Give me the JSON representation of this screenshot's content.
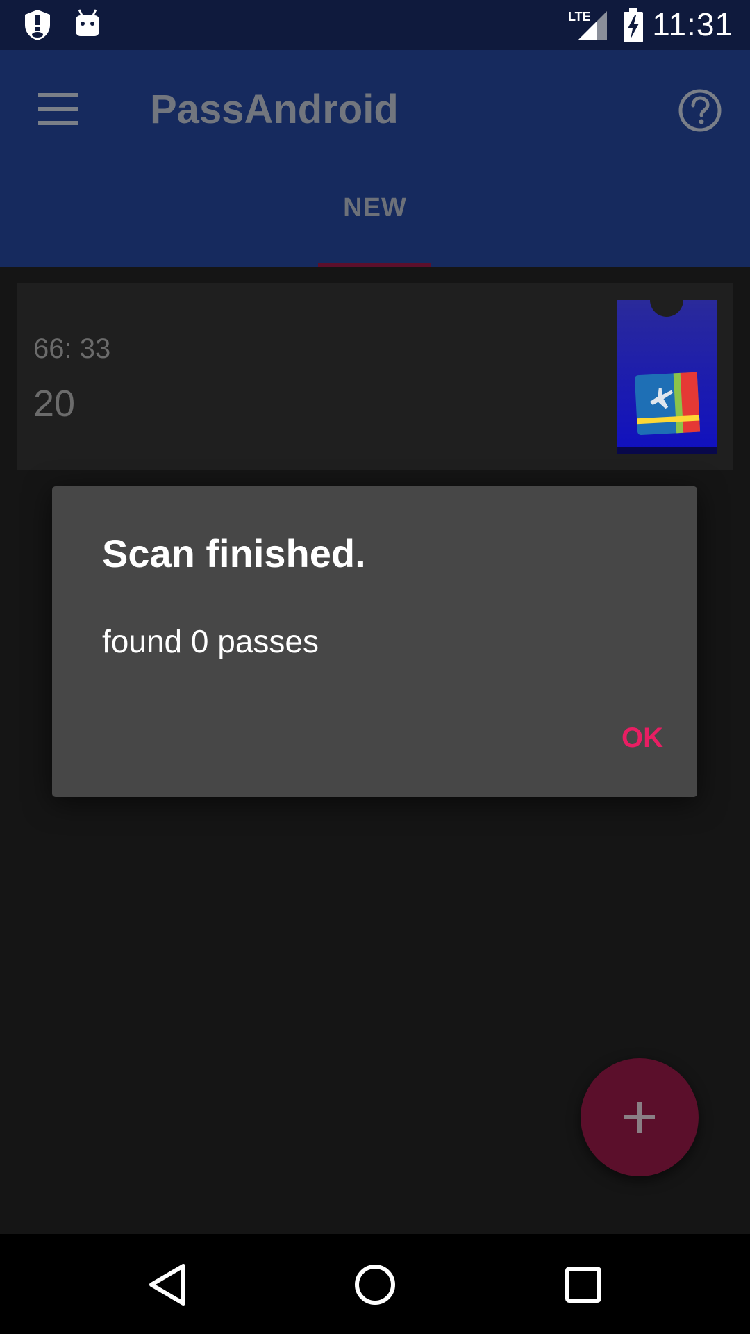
{
  "status_bar": {
    "time": "11:31",
    "network_label": "LTE",
    "icons": [
      "vpn-shield-icon",
      "android-debug-icon",
      "lte-signal-icon",
      "battery-charging-icon"
    ]
  },
  "app_bar": {
    "title": "PassAndroid",
    "menu_icon": "hamburger-menu-icon",
    "help_icon": "help-circle-icon",
    "tabs": [
      {
        "label": "NEW",
        "selected": true
      }
    ]
  },
  "pass_list": {
    "items": [
      {
        "line1": "66: 33",
        "line2": "20",
        "icon": "boarding-pass-icon"
      }
    ]
  },
  "dialog": {
    "title": "Scan finished.",
    "message": "found 0 passes",
    "ok_label": "OK"
  },
  "fab": {
    "icon": "plus-icon"
  },
  "nav_bar": {
    "icons": [
      "back-triangle-icon",
      "home-circle-icon",
      "recents-square-icon"
    ]
  },
  "colors": {
    "accent": "#e91e63",
    "primary_dimmed": "#162a5e",
    "dialog_background": "#474747"
  }
}
